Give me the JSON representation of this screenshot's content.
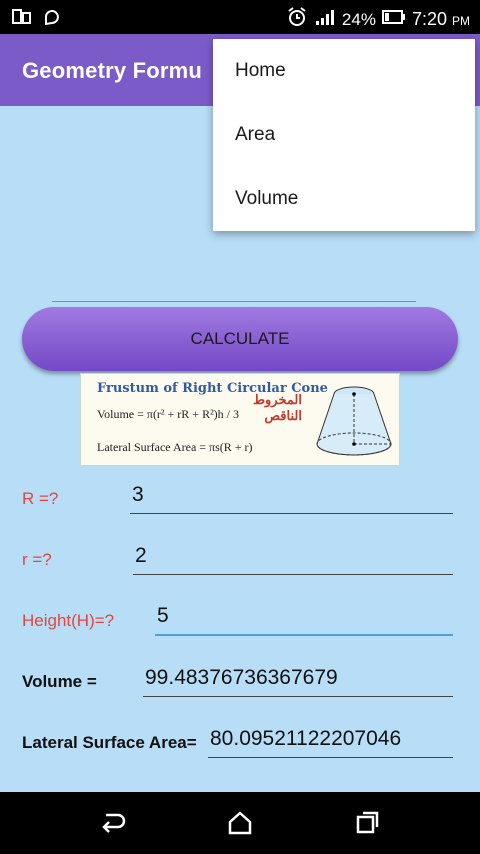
{
  "status_bar": {
    "battery": "24%",
    "time": "7:20",
    "ampm": "PM",
    "icons": [
      "screen-icon",
      "circle-app-icon",
      "alarm-icon",
      "signal-icon",
      "battery-icon"
    ]
  },
  "app_bar": {
    "title": "Geometry Formu"
  },
  "menu": {
    "items": [
      {
        "label": "Home"
      },
      {
        "label": "Area"
      },
      {
        "label": "Volume"
      }
    ]
  },
  "calculate_label": "CALCULATE",
  "formula_image": {
    "title": "Frustum of Right Circular Cone",
    "volume_formula": "Volume = π(r² + rR + R²)h / 3",
    "lateral_formula": "Lateral Surface Area = πs(R + r)",
    "arabic_line1": "المخروط",
    "arabic_line2": "الناقص"
  },
  "fields": {
    "R": {
      "label": "R =?",
      "value": "3"
    },
    "r": {
      "label": "r =?",
      "value": "2"
    },
    "height": {
      "label": "Height(H)=?",
      "value": "5"
    },
    "volume": {
      "label": "Volume =",
      "value": "99.48376736367679"
    },
    "lateral": {
      "label": "Lateral Surface Area=",
      "value": "80.09521122207046"
    }
  },
  "colors": {
    "app_bar": "#7b5bc8",
    "background": "#b7ddf7",
    "input_label": "#e8453c",
    "accent": "#4aa3df"
  }
}
